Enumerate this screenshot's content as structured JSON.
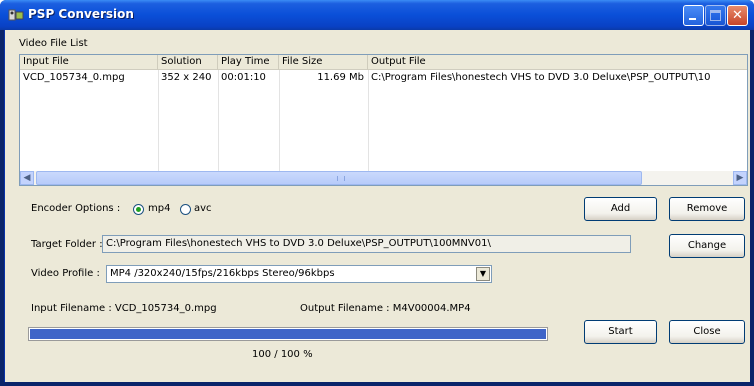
{
  "window": {
    "title": "PSP Conversion"
  },
  "list": {
    "label": "Video File List",
    "columns": [
      "Input File",
      "Solution",
      "Play Time",
      "File Size",
      "Output File"
    ],
    "rows": [
      [
        "VCD_105734_0.mpg",
        "352 x 240",
        "00:01:10",
        "11.69 Mb",
        "C:\\Program Files\\honestech VHS to DVD 3.0 Deluxe\\PSP_OUTPUT\\10"
      ]
    ]
  },
  "encoder": {
    "label": "Encoder Options :",
    "options": [
      "mp4",
      "avc"
    ],
    "selected": "mp4"
  },
  "buttons": {
    "add": "Add",
    "remove": "Remove",
    "change": "Change",
    "start": "Start",
    "close": "Close"
  },
  "target": {
    "label": "Target Folder :",
    "value": "C:\\Program Files\\honestech VHS to DVD 3.0 Deluxe\\PSP_OUTPUT\\100MNV01\\"
  },
  "profile": {
    "label": "Video Profile :",
    "value": "MP4  /320x240/15fps/216kbps   Stereo/96kbps"
  },
  "input_filename": "Input Filename :  VCD_105734_0.mpg",
  "output_filename": "Output Filename :  M4V00004.MP4",
  "progress": {
    "fraction": 1.0,
    "text": "100 / 100 %"
  },
  "colors": {
    "progress_fill": "#3f65c8",
    "title_bar": "#0a4fd8"
  }
}
